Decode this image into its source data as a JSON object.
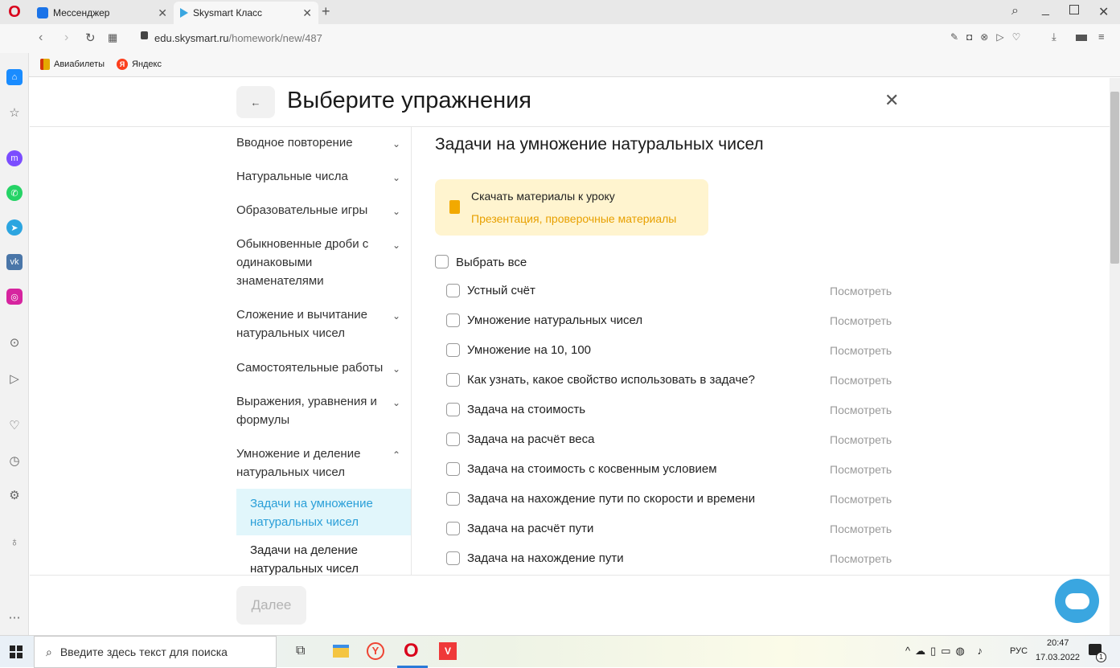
{
  "browser": {
    "tabs": [
      {
        "label": "Мессенджер",
        "active": false
      },
      {
        "label": "Skysmart Класс",
        "active": true
      }
    ],
    "url": {
      "domain": "edu.skysmart.ru",
      "path": "/homework/new/487"
    },
    "bookmarks": [
      {
        "label": "Авиабилеты"
      },
      {
        "label": "Яндекс"
      }
    ]
  },
  "header": {
    "back_icon": "arrow-left",
    "title": "Выберите упражнения",
    "close_icon": "close"
  },
  "menu": {
    "items": [
      {
        "label": "Вводное повторение",
        "expanded": false
      },
      {
        "label": "Натуральные числа",
        "expanded": false
      },
      {
        "label": "Образовательные игры",
        "expanded": false
      },
      {
        "label": "Обыкновенные дроби с одинаковыми знаменателями",
        "expanded": false
      },
      {
        "label": "Сложение и вычитание натуральных чисел",
        "expanded": false
      },
      {
        "label": "Самостоятельные работы",
        "expanded": false
      },
      {
        "label": "Выражения, уравнения и формулы",
        "expanded": false
      },
      {
        "label": "Умножение и деление натуральных чисел",
        "expanded": true
      }
    ],
    "subitems": [
      {
        "label": "Задачи на умножение натуральных чисел",
        "selected": true
      },
      {
        "label": "Задачи на деление натуральных чисел",
        "selected": false
      }
    ]
  },
  "main": {
    "section_title": "Задачи на умножение натуральных чисел",
    "download": {
      "title": "Скачать материалы к уроку",
      "link": "Презентация, проверочные материалы"
    },
    "select_all": "Выбрать все",
    "view_label": "Посмотреть",
    "exercises": [
      {
        "label": "Устный счёт",
        "checked": false
      },
      {
        "label": "Умножение натуральных чисел",
        "checked": false
      },
      {
        "label": "Умножение на 10, 100",
        "checked": false
      },
      {
        "label": "Как узнать, какое свойство использовать в задаче?",
        "checked": false
      },
      {
        "label": "Задача на стоимость",
        "checked": false
      },
      {
        "label": "Задача на расчёт веса",
        "checked": false
      },
      {
        "label": "Задача на стоимость с косвенным условием",
        "checked": false
      },
      {
        "label": "Задача на нахождение пути по скорости и времени",
        "checked": false
      },
      {
        "label": "Задача на расчёт пути",
        "checked": false
      },
      {
        "label": "Задача на нахождение пути",
        "checked": false
      }
    ]
  },
  "footer": {
    "next_button": "Далее"
  },
  "taskbar": {
    "search_placeholder": "Введите здесь текст для поиска",
    "lang": "РУС",
    "time": "20:47",
    "date": "17.03.2022",
    "notifications": "1"
  },
  "colors": {
    "accent_blue": "#2a9fd8",
    "selected_bg": "#e1f6fb",
    "download_bg": "#fff4cf",
    "download_link": "#e8a000",
    "chat_button": "#3aa6e0"
  }
}
